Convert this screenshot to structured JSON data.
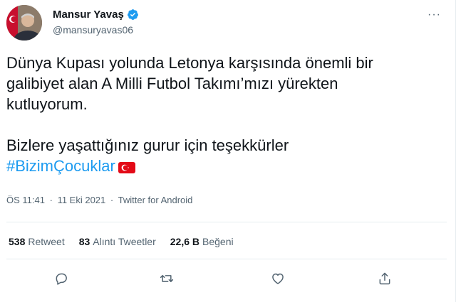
{
  "author": {
    "display_name": "Mansur Yavaş",
    "handle": "@mansuryavas06",
    "verified": true
  },
  "more_label": "···",
  "tweet": {
    "line1": "Dünya Kupası yolunda Letonya karşısında önemli bir",
    "line2": "galibiyet alan A Milli Futbol Takımı’mızı yürekten",
    "line3": "kutluyorum.",
    "line4": "Bizlere yaşattığınız gurur için teşekkürler",
    "hashtag": "#BizimÇocuklar"
  },
  "meta": {
    "time": "ÖS 11:41",
    "separator": "·",
    "date": "11 Eki 2021",
    "source": "Twitter for Android"
  },
  "stats": {
    "retweets_count": "538",
    "retweets_label": "Retweet",
    "quotes_count": "83",
    "quotes_label": "Alıntı Tweetler",
    "likes_count": "22,6 B",
    "likes_label": "Beğeni"
  },
  "icons": {
    "reply": "reply-icon",
    "retweet": "retweet-icon",
    "like": "heart-icon",
    "share": "share-icon",
    "flag": "turkey-flag-icon"
  },
  "colors": {
    "accent": "#1d9bf0",
    "text": "#0f1419",
    "secondary": "#536471",
    "flag": "#e30a17"
  }
}
